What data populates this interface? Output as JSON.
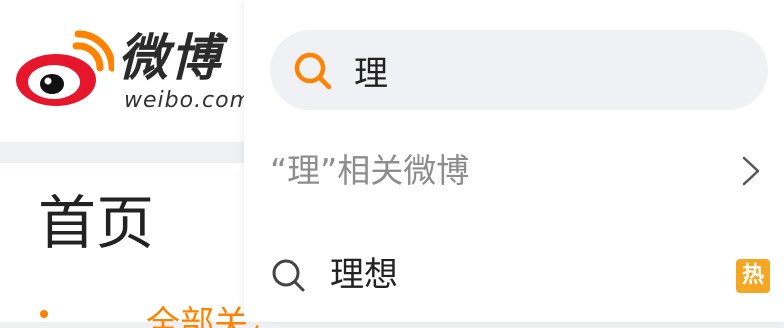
{
  "logo": {
    "name": "微博",
    "domain": "weibo.com"
  },
  "nav": {
    "home_title": "首页",
    "all_follow_label": "全部关注"
  },
  "search": {
    "query": "理",
    "related_label": "“理”相关微博",
    "suggestions": [
      {
        "label": "理想",
        "badge": "热"
      }
    ]
  },
  "colors": {
    "accent": "#ff8200",
    "hot_badge": "#f5a623",
    "muted_text": "#8d8d8d"
  }
}
